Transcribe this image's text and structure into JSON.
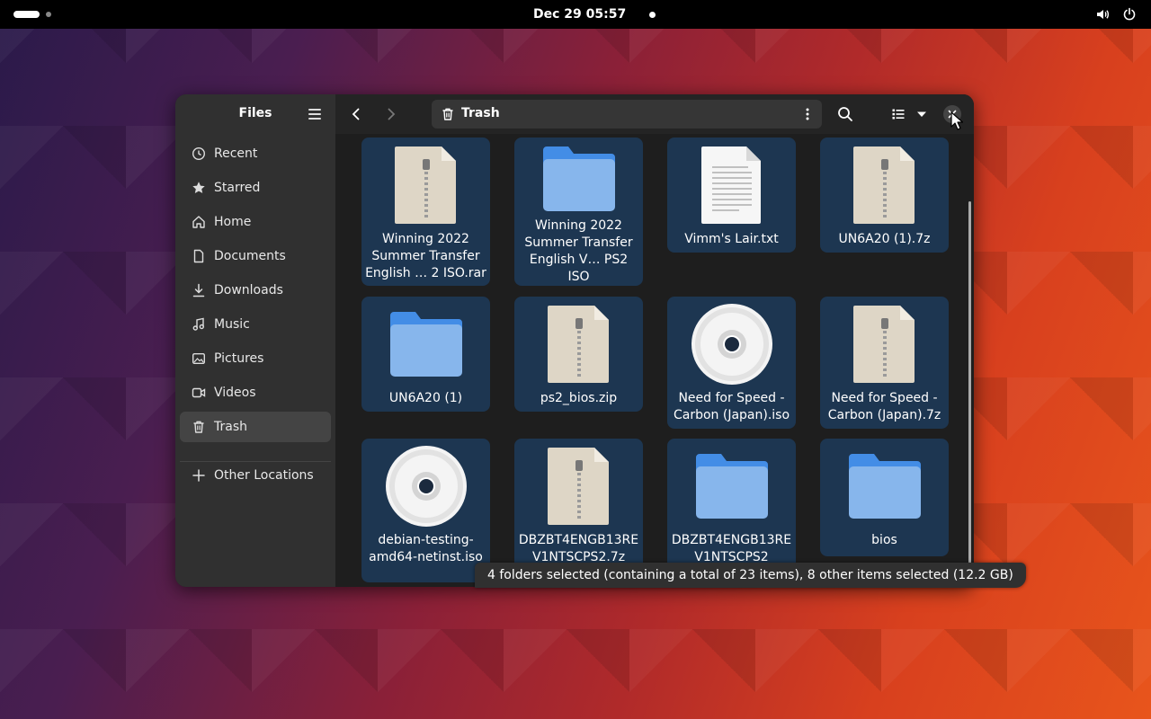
{
  "topbar": {
    "datetime": "Dec 29  05:57"
  },
  "sidebar": {
    "title": "Files",
    "items": [
      {
        "label": "Recent",
        "icon": "clock-icon"
      },
      {
        "label": "Starred",
        "icon": "star-icon"
      },
      {
        "label": "Home",
        "icon": "home-icon"
      },
      {
        "label": "Documents",
        "icon": "document-icon"
      },
      {
        "label": "Downloads",
        "icon": "download-icon"
      },
      {
        "label": "Music",
        "icon": "music-icon"
      },
      {
        "label": "Pictures",
        "icon": "picture-icon"
      },
      {
        "label": "Videos",
        "icon": "video-icon"
      },
      {
        "label": "Trash",
        "icon": "trash-icon",
        "active": true
      }
    ],
    "other_locations": "Other Locations"
  },
  "toolbar": {
    "location": "Trash"
  },
  "files": [
    {
      "name": "Winning 2022\nSummer Transfer\nEnglish …  2 ISO.rar",
      "type": "archive",
      "selected": true
    },
    {
      "name": "Winning 2022\nSummer Transfer\nEnglish V…  PS2 ISO",
      "type": "folder",
      "selected": true
    },
    {
      "name": "Vimm's Lair.txt",
      "type": "text",
      "selected": true
    },
    {
      "name": "UN6A20 (1).7z",
      "type": "archive",
      "selected": true
    },
    {
      "name": "UN6A20 (1)",
      "type": "folder",
      "selected": true
    },
    {
      "name": "ps2_bios.zip",
      "type": "archive",
      "selected": true
    },
    {
      "name": "Need for Speed -\nCarbon (Japan).iso",
      "type": "disc",
      "selected": true
    },
    {
      "name": "Need for Speed -\nCarbon (Japan).7z",
      "type": "archive",
      "selected": true
    },
    {
      "name": "debian-testing-\namd64-netinst.iso",
      "type": "disc",
      "selected": true
    },
    {
      "name": "DBZBT4ENGB13RE\nV1NTSCPS2.7z",
      "type": "archive",
      "selected": true
    },
    {
      "name": "DBZBT4ENGB13RE\nV1NTSCPS2",
      "type": "folder",
      "selected": true
    },
    {
      "name": "bios",
      "type": "folder",
      "selected": true
    }
  ],
  "status": "4 folders selected (containing a total of 23 items), 8 other items selected (12.2 GB)",
  "colors": {
    "selection": "#1d3651",
    "folder": "#87b6ec",
    "folder_tab": "#438de6"
  }
}
